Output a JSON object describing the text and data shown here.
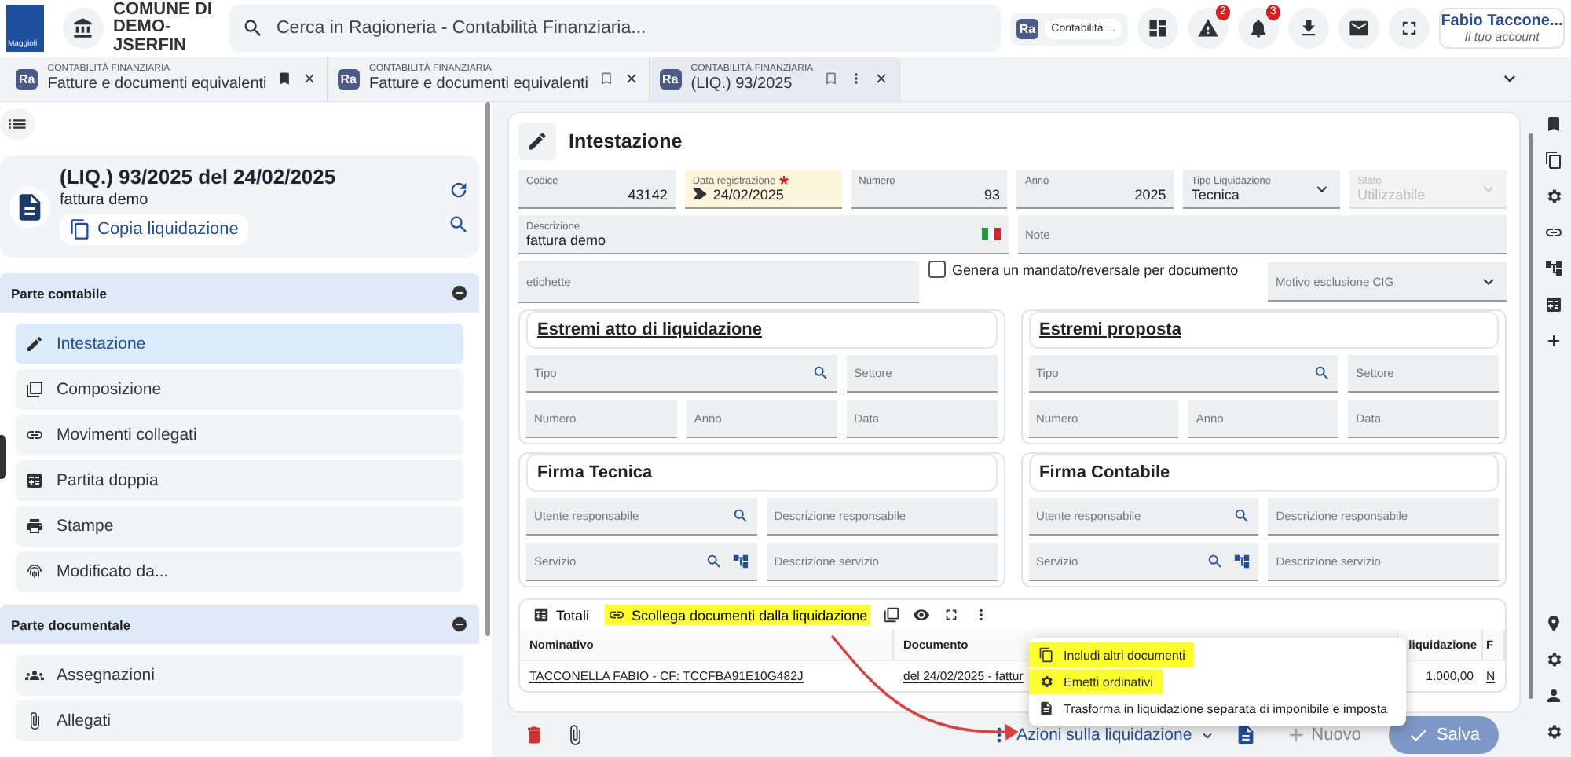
{
  "topbar": {
    "logo_text": "Maggioli",
    "institution": "COMUNE DI DEMO-JSERFIN",
    "search": {
      "placeholder": "Cerca in Ragioneria - Contabilità Finanziaria..."
    },
    "app_badge": "Ra",
    "app_name": "Contabilità ...",
    "alerts_badge": "2",
    "notifications_badge": "3",
    "user": {
      "name": "Fabio Taccone...",
      "subtitle": "Il tuo account"
    }
  },
  "tabs": [
    {
      "badge": "Ra",
      "category": "CONTABILITÀ FINANZIARIA",
      "title": "Fatture e documenti equivalenti",
      "bookmarked": true,
      "selected": false
    },
    {
      "badge": "Ra",
      "category": "CONTABILITÀ FINANZIARIA",
      "title": "Fatture e documenti equivalenti",
      "bookmarked": false,
      "selected": false
    },
    {
      "badge": "Ra",
      "category": "CONTABILITÀ FINANZIARIA",
      "title": "(LIQ.) 93/2025",
      "bookmarked": false,
      "selected": true
    }
  ],
  "record": {
    "title": "(LIQ.) 93/2025 del 24/02/2025",
    "subtitle": "fattura demo",
    "copy_button": "Copia liquidazione"
  },
  "sidebar": [
    {
      "title": "Parte contabile",
      "expanded": true,
      "items": [
        {
          "label": "Intestazione",
          "selected": true
        },
        {
          "label": "Composizione",
          "selected": false
        },
        {
          "label": "Movimenti collegati",
          "selected": false
        },
        {
          "label": "Partita doppia",
          "selected": false
        },
        {
          "label": "Stampe",
          "selected": false
        },
        {
          "label": "Modificato da...",
          "selected": false
        }
      ]
    },
    {
      "title": "Parte documentale",
      "expanded": true,
      "items": [
        {
          "label": "Assegnazioni",
          "selected": false
        },
        {
          "label": "Allegati",
          "selected": false
        }
      ]
    }
  ],
  "form": {
    "title": "Intestazione",
    "rows": [
      [
        {
          "kind": "number",
          "label": "Codice",
          "value": "43142"
        },
        {
          "kind": "date",
          "label": "Data registrazione",
          "value": "24/02/2025",
          "required": true
        },
        {
          "kind": "number",
          "label": "Numero",
          "value": "93"
        },
        {
          "kind": "number",
          "label": "Anno",
          "value": "2025"
        },
        {
          "kind": "select",
          "label": "Tipo Liquidazione",
          "value": "Tecnica"
        },
        {
          "kind": "select",
          "label": "Stato",
          "value": "Utilizzabile",
          "disabled": true
        }
      ],
      [
        {
          "kind": "flag",
          "label": "Descrizione",
          "value": "fattura demo"
        },
        {
          "kind": "text",
          "placeholder": "Note"
        }
      ],
      [
        {
          "kind": "tags",
          "placeholder": "etichette"
        },
        {
          "kind": "checkbox",
          "label": "Genera un mandato/reversale per documento",
          "checked": false
        },
        {
          "kind": "select",
          "placeholder": "Motivo esclusione CIG"
        }
      ]
    ]
  },
  "sections": [
    {
      "kind": "estremi",
      "title": "Estremi atto di liquidazione",
      "fields": [
        {
          "placeholder": "Tipo",
          "kind": "lookup"
        },
        {
          "placeholder": "Settore",
          "kind": "plain"
        },
        {
          "placeholder": "Numero",
          "kind": "plain"
        },
        {
          "placeholder": "Anno",
          "kind": "plain"
        },
        {
          "placeholder": "Data",
          "kind": "plain"
        }
      ]
    },
    {
      "kind": "estremi",
      "title": "Estremi proposta",
      "fields": [
        {
          "placeholder": "Tipo",
          "kind": "lookup"
        },
        {
          "placeholder": "Settore",
          "kind": "plain"
        },
        {
          "placeholder": "Numero",
          "kind": "plain"
        },
        {
          "placeholder": "Anno",
          "kind": "plain"
        },
        {
          "placeholder": "Data",
          "kind": "plain"
        }
      ]
    },
    {
      "kind": "firma",
      "title": "Firma Tecnica",
      "fields": [
        {
          "placeholder": "Utente responsabile",
          "kind": "lookup"
        },
        {
          "placeholder": "Descrizione responsabile",
          "kind": "plain"
        },
        {
          "placeholder": "Servizio",
          "kind": "lookup_tree"
        },
        {
          "placeholder": "Descrizione servizio",
          "kind": "plain"
        }
      ]
    },
    {
      "kind": "firma",
      "title": "Firma Contabile",
      "fields": [
        {
          "placeholder": "Utente responsabile",
          "kind": "lookup"
        },
        {
          "placeholder": "Descrizione responsabile",
          "kind": "plain"
        },
        {
          "placeholder": "Servizio",
          "kind": "lookup_tree"
        },
        {
          "placeholder": "Descrizione servizio",
          "kind": "plain"
        }
      ]
    }
  ],
  "table": {
    "totals_button": "Totali",
    "unlink_button": "Scollega documenti dalla liquidazione",
    "columns": [
      "Nominativo",
      "Documento",
      "liquidazione",
      "F"
    ],
    "rows": [
      [
        "TACCONELLA FABIO - CF: TCCFBA91E10G482J",
        "del 24/02/2025 - fattur",
        "1.000,00",
        "N"
      ]
    ]
  },
  "menu": [
    {
      "label": "Includi altri documenti",
      "highlighted": true
    },
    {
      "label": "Emetti ordinativi",
      "highlighted": true
    },
    {
      "label": "Trasforma in liquidazione separata di imponibile e imposta",
      "highlighted": false
    }
  ],
  "footer": {
    "actions_button": "Azioni sulla liquidazione",
    "new_button": {
      "label": "Nuovo",
      "disabled": true
    },
    "save_button": {
      "label": "Salva",
      "disabled": true
    }
  }
}
